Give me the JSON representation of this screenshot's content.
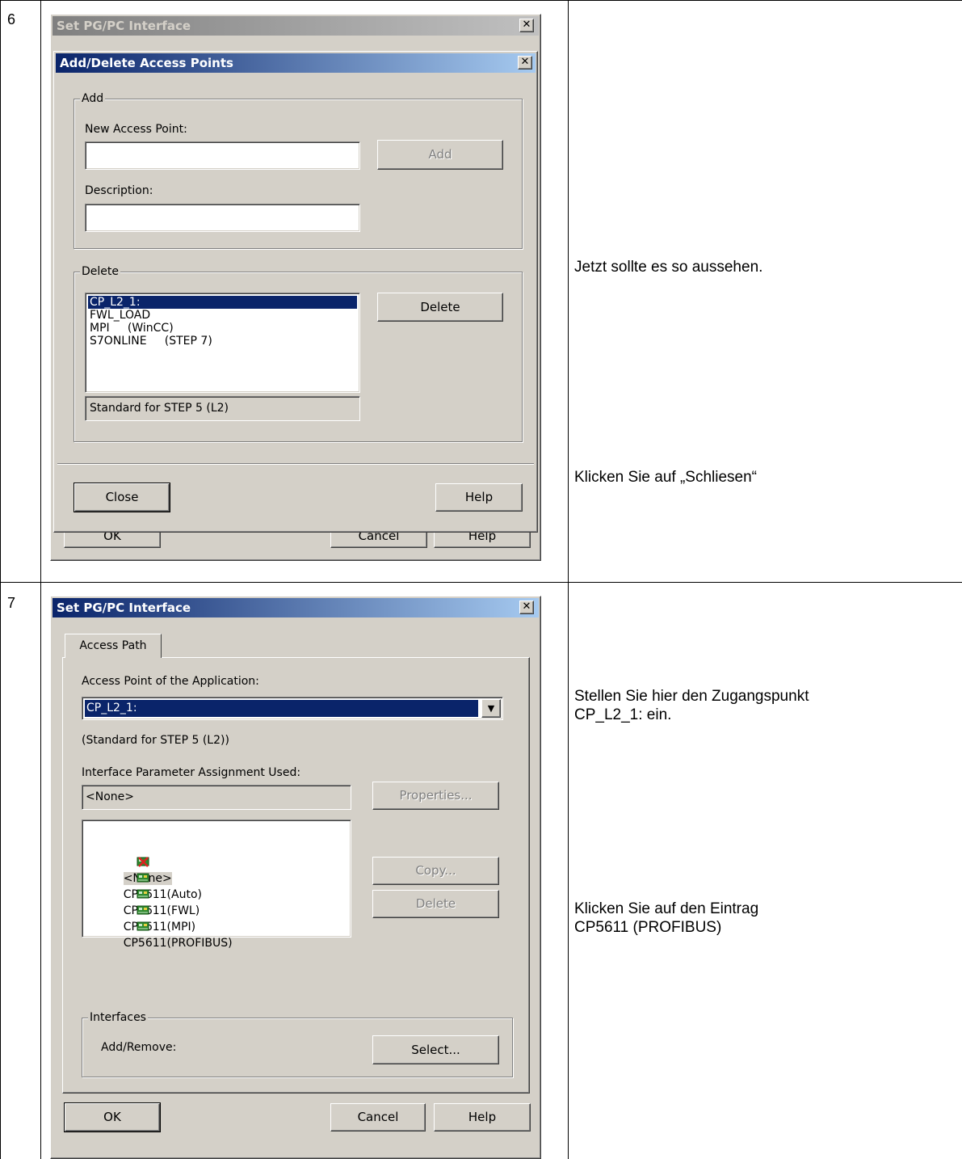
{
  "steps": [
    {
      "number": "6",
      "instructions": [
        "Jetzt sollte es so aussehen.",
        "Klicken Sie auf „Schliesen“"
      ],
      "dialog": {
        "parent_title": "Set PG/PC Interface",
        "title": "Add/Delete Access Points",
        "add_group": {
          "label": "Add",
          "new_access_point_label": "New Access Point:",
          "new_access_point_value": "",
          "add_button": "Add",
          "description_label": "Description:",
          "description_value": ""
        },
        "delete_group": {
          "label": "Delete",
          "items": [
            "CP_L2_1:",
            "FWL_LOAD",
            "MPI     (WinCC)",
            "S7ONLINE     (STEP 7)"
          ],
          "selected_index": 0,
          "delete_button": "Delete",
          "description_text": "Standard for STEP 5 (L2)"
        },
        "close_button": "Close",
        "help_button": "Help",
        "parent_buttons": {
          "ok": "OK",
          "cancel": "Cancel",
          "help": "Help"
        }
      }
    },
    {
      "number": "7",
      "instructions": [
        "Stellen Sie hier den Zugangspunkt\nCP_L2_1: ein.",
        "Klicken Sie auf den Eintrag\nCP5611 (PROFIBUS)"
      ],
      "dialog": {
        "title": "Set PG/PC Interface",
        "tab": "Access Path",
        "access_point_label": "Access Point of the Application:",
        "access_point_value": "CP_L2_1:",
        "access_point_description": "(Standard for STEP 5 (L2))",
        "param_label": "Interface Parameter Assignment Used:",
        "param_value": "<None>",
        "properties_button": "Properties...",
        "param_items": [
          "<None>",
          "CP5611(Auto)",
          "CP5611(FWL)",
          "CP5611(MPI)",
          "CP5611(PROFIBUS)"
        ],
        "copy_button": "Copy...",
        "delete_button": "Delete",
        "interfaces_label": "Interfaces",
        "add_remove_label": "Add/Remove:",
        "select_button": "Select...",
        "ok_button": "OK",
        "cancel_button": "Cancel",
        "help_button": "Help"
      }
    }
  ],
  "colors": {
    "title_active": "#0a246a",
    "face": "#d4d0c8",
    "selection": "#0a246a"
  }
}
